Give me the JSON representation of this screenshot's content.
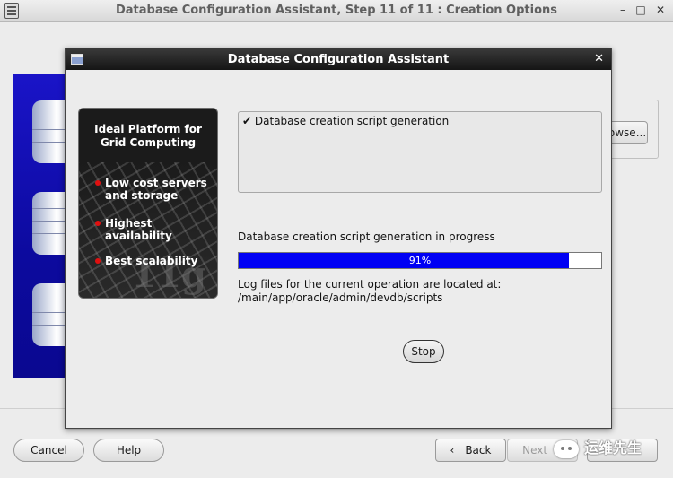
{
  "window": {
    "title": "Database Configuration Assistant, Step 11 of 11 : Creation Options",
    "controls": [
      "–",
      "□",
      "✕"
    ]
  },
  "background": {
    "browse_label": "Browse..."
  },
  "footer": {
    "cancel": "Cancel",
    "help": "Help",
    "back": "Back",
    "back_icon": "‹",
    "next": "Next",
    "next_icon": "›"
  },
  "dialog": {
    "title": "Database Configuration Assistant",
    "close": "✕",
    "promo": {
      "heading_line1": "Ideal Platform for",
      "heading_line2": "Grid Computing",
      "bullets": [
        "Low cost servers",
        "and storage",
        "Highest availability",
        "Best scalability"
      ],
      "logo_text": "11g"
    },
    "steps": [
      {
        "mark": "✔",
        "label": "Database creation script generation"
      }
    ],
    "progress": {
      "label": "Database creation script generation in progress",
      "percent": 91,
      "percent_text": "91%"
    },
    "log_line1": "Log files for the current operation are located at:",
    "log_line2": "/main/app/oracle/admin/devdb/scripts",
    "stop": "Stop"
  },
  "watermark": {
    "text": "运维先生",
    "icon": "wechat-icon"
  },
  "colors": {
    "progress_fill": "#0000f4",
    "banner_blue": "#0c0a9e",
    "bullet_red": "#e01010"
  }
}
